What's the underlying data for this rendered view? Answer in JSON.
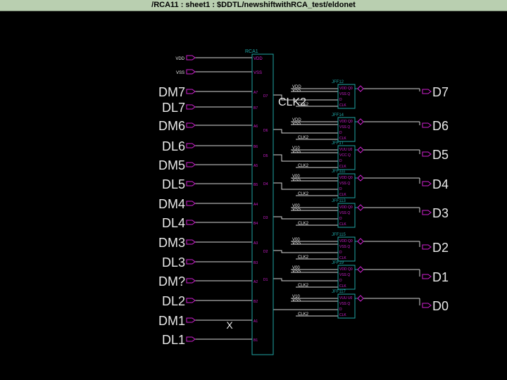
{
  "window": {
    "title": "/RCA11 : sheet1 : $DDTL/newshiftwithRCA_test/eldonet"
  },
  "colors": {
    "wire": "#d8d8d8",
    "component": "#1fa5a5",
    "pin_text": "#d020d0",
    "port_text": "#e8e8e8",
    "background": "#000000"
  },
  "rca": {
    "name": "RCA1",
    "pin_vdd": "VDD",
    "pin_vss": "VSS",
    "a_pins": [
      "A7",
      "A6",
      "A5",
      "A4",
      "A3",
      "A2",
      "A1"
    ],
    "b_pins": [
      "B7",
      "B6",
      "B5",
      "B4",
      "B3",
      "B2",
      "B1"
    ],
    "out_pins": [
      "D7",
      "D6",
      "D5",
      "D4",
      "D3",
      "D2",
      "D1"
    ]
  },
  "supply_ports": [
    "VDD",
    "VSS"
  ],
  "input_ports": [
    "DM7",
    "DL7",
    "DM6",
    "DL6",
    "DM5",
    "DL5",
    "DM4",
    "DL4",
    "DM3",
    "DL3",
    "DM?",
    "DL2",
    "DM1",
    "DL1"
  ],
  "no_connect_marker": "X",
  "clock_label": "CLK2",
  "flipflops": [
    {
      "name": "JFF12",
      "vdd": "VDD",
      "vss": "VSS",
      "clk": "CLK2",
      "pins": [
        "VDD Q0",
        "VSS Q",
        "D",
        "CLK"
      ],
      "output": "D7"
    },
    {
      "name": "JFF14",
      "vdd": "VDD",
      "vss": "VSS",
      "clk": "CLK2",
      "pins": [
        "VDD Q0",
        "VSS Q",
        "D",
        "CLK"
      ],
      "output": "D6"
    },
    {
      "name": "JFF1T",
      "vdd": "V10",
      "vss": "VSS",
      "clk": "CLK2",
      "pins": [
        "VUU U0",
        "VCC Q",
        "D",
        "CLK"
      ],
      "output": "D5"
    },
    {
      "name": "JFF111",
      "vdd": "V00",
      "vss": "VSS",
      "clk": "CLK2",
      "pins": [
        "VDD Q0",
        "VSS Q",
        "D",
        "CLK"
      ],
      "output": "D4"
    },
    {
      "name": "JFF113",
      "vdd": "V00",
      "vss": "VSS",
      "clk": "CLK2",
      "pins": [
        "VDD Q0",
        "VSS Q",
        "D",
        "CLK"
      ],
      "output": "D3"
    },
    {
      "name": "JFF115",
      "vdd": "V00",
      "vss": "VSS",
      "clk": "CLK2",
      "pins": [
        "VDD Q0",
        "VSS Q",
        "D",
        "CLK"
      ],
      "output": "D2"
    },
    {
      "name": "JFF19",
      "vdd": "V00",
      "vss": "VSS",
      "clk": "CLK2",
      "pins": [
        "VDD Q0",
        "VSS Q",
        "D",
        "CLK"
      ],
      "output": "D1"
    },
    {
      "name": "JFF117",
      "vdd": "V10",
      "vss": "VSS",
      "clk": "CLK2",
      "pins": [
        "VUU U0",
        "VSS Q",
        "D",
        "CLK"
      ],
      "output": "D0"
    }
  ]
}
